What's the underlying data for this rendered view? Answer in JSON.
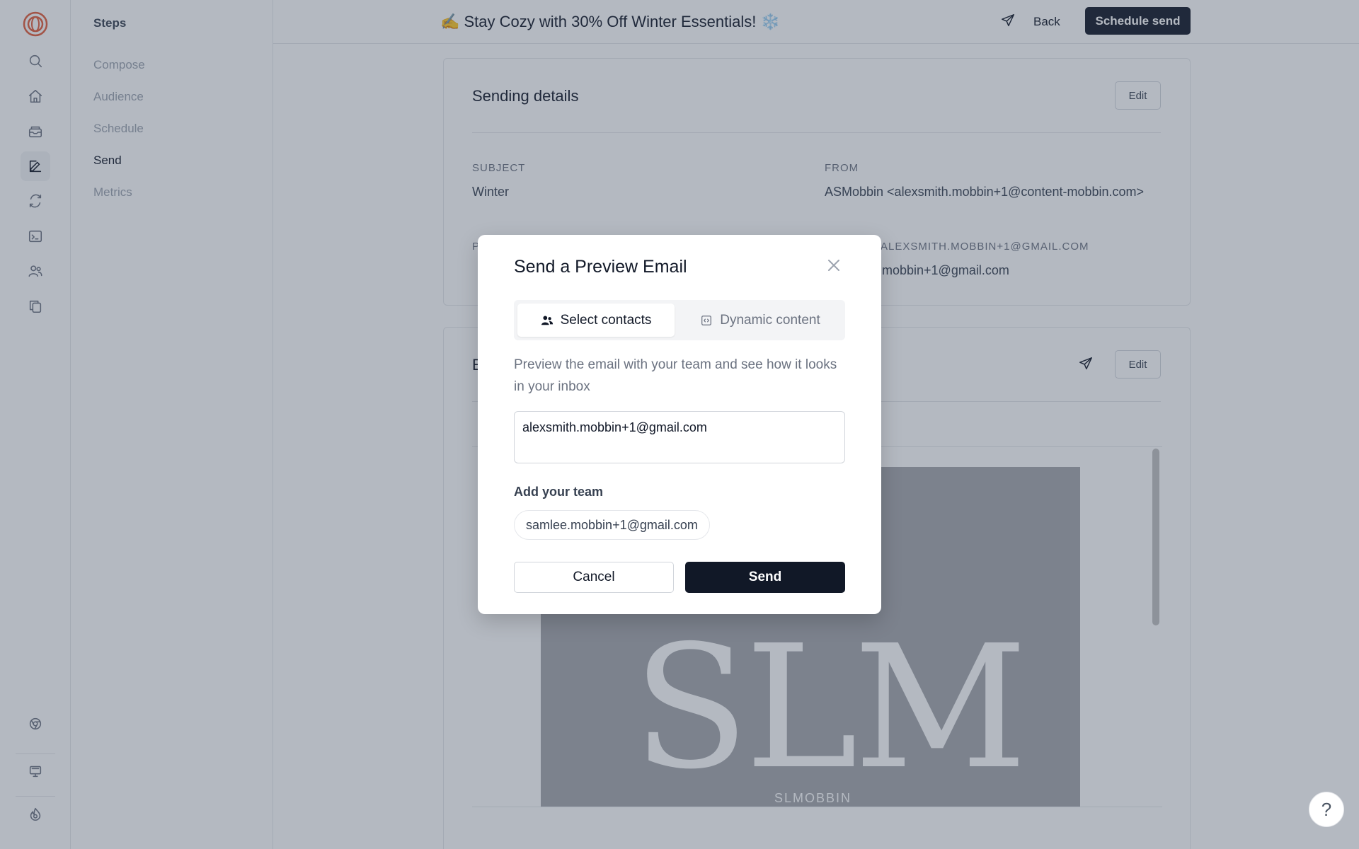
{
  "app": {
    "campaign_title": "✍️ Stay Cozy with 30% Off Winter Essentials! ❄️"
  },
  "rail": {
    "icons": [
      "logo-icon",
      "search-icon",
      "home-icon",
      "inbox-icon",
      "compose-icon",
      "refresh-icon",
      "terminal-icon",
      "users-icon",
      "copy-icon",
      "chrome-icon",
      "monitor-icon",
      "flame-icon"
    ],
    "active": "compose-icon"
  },
  "steps": {
    "title": "Steps",
    "items": [
      {
        "label": "Compose"
      },
      {
        "label": "Audience"
      },
      {
        "label": "Schedule"
      },
      {
        "label": "Send"
      },
      {
        "label": "Metrics"
      }
    ],
    "active": "Send"
  },
  "topbar": {
    "back_label": "Back",
    "schedule_label": "Schedule send"
  },
  "sending_details": {
    "title": "Sending details",
    "edit_label": "Edit",
    "subject_label": "SUBJECT",
    "subject_value": "Winter",
    "from_label": "FROM",
    "from_value": "ASMobbin <alexsmith.mobbin+1@content-mobbin.com>",
    "preview_label_partial": "P",
    "reply_label_partial": "ALEXSMITH.MOBBIN+1@GMAIL.COM",
    "reply_value_partial": ".mobbin+1@gmail.com"
  },
  "email_card": {
    "title_partial": "E",
    "edit_label": "Edit",
    "logo_text": "SLM",
    "logo_subtext": "SLMOBBIN"
  },
  "modal": {
    "title": "Send a Preview Email",
    "tabs": [
      {
        "label": "Select contacts",
        "icon": "users-icon",
        "active": true
      },
      {
        "label": "Dynamic content",
        "icon": "code-icon",
        "active": false
      }
    ],
    "description": "Preview the email with your team and see how it looks in your inbox",
    "emails_value": "alexsmith.mobbin+1@gmail.com",
    "team_label": "Add your team",
    "team_members": [
      "samlee.mobbin+1@gmail.com"
    ],
    "cancel_label": "Cancel",
    "send_label": "Send"
  },
  "help": {
    "label": "?"
  },
  "colors": {
    "primary": "#111827",
    "overlay": "rgba(58,70,92,0.38)",
    "muted_text": "#6b7280",
    "border": "#e5e7eb"
  }
}
